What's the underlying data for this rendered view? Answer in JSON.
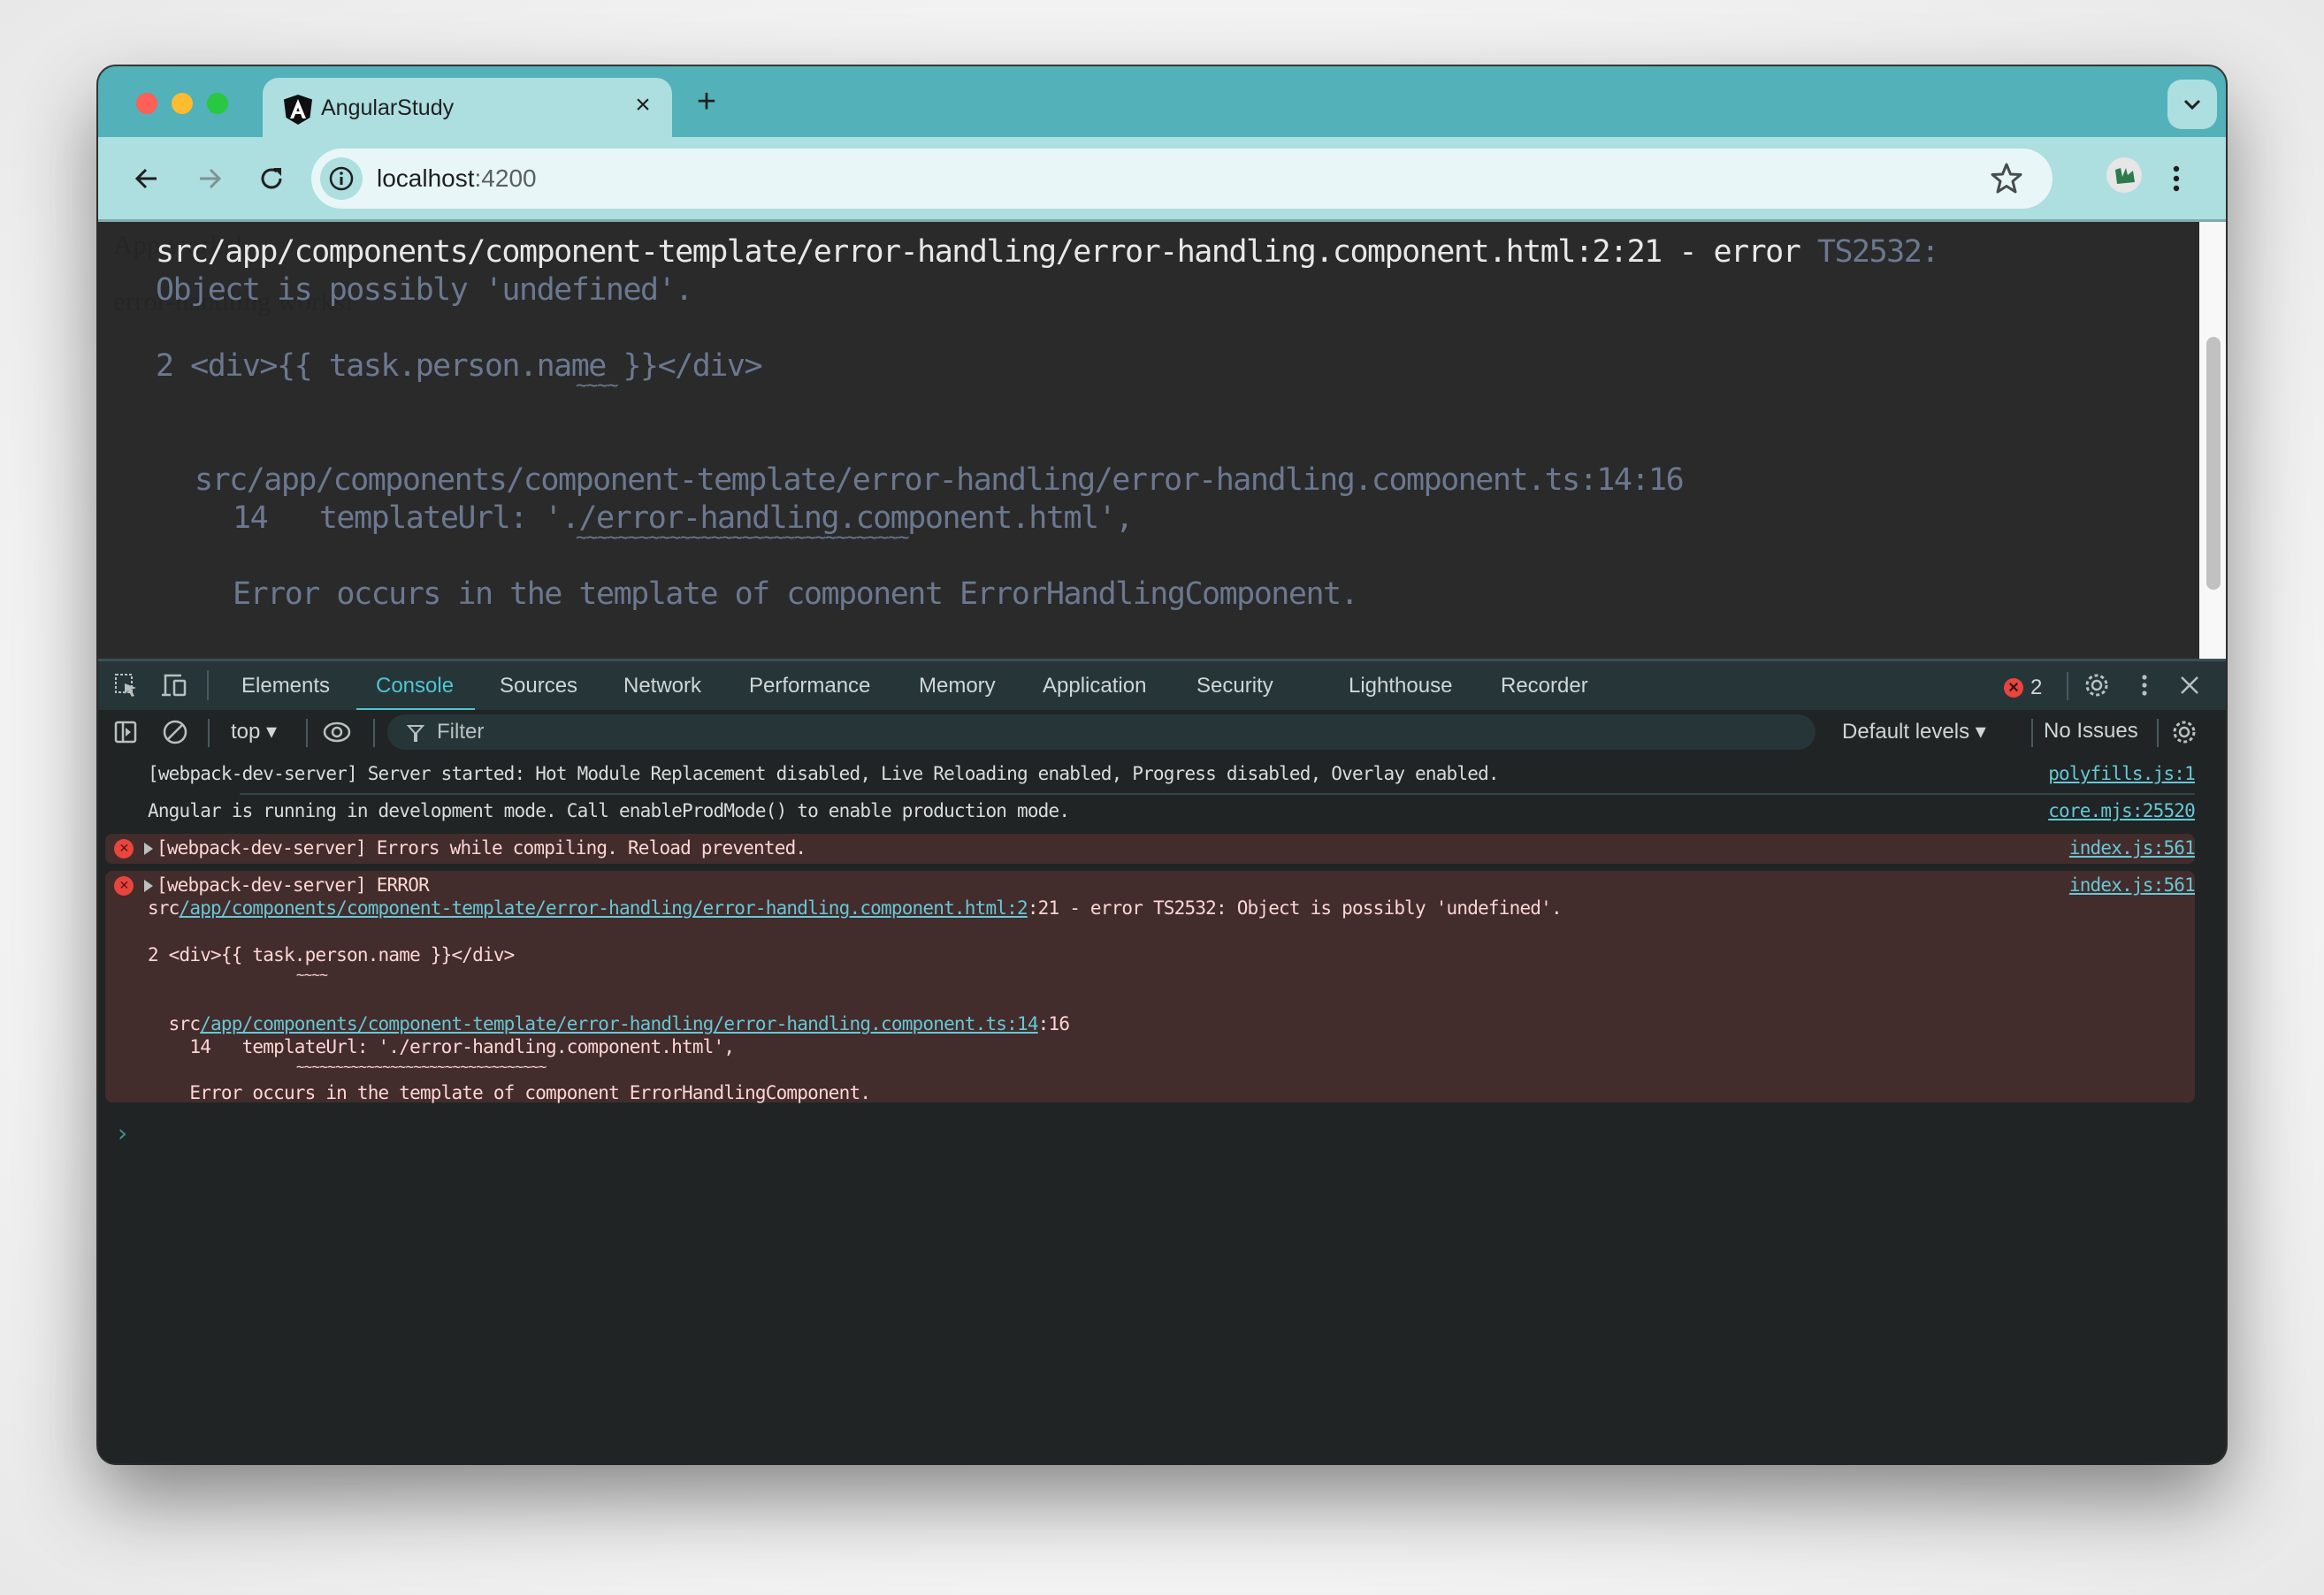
{
  "browser": {
    "tab": {
      "title": "AngularStudy",
      "favicon": "angular-icon",
      "close": "×"
    },
    "new_tab": "+",
    "address": {
      "host": "localhost",
      "port": ":4200"
    }
  },
  "page": {
    "underlying_text": [
      "App works!",
      "error-handling works!"
    ],
    "overlay": {
      "line1_white": "src/app/components/component-template/error-handling/error-handling.component.html:2:21 - error ",
      "line1_code": "TS2532:",
      "line2": "Object is possibly 'undefined'.",
      "code_line": "2 <div>{{ task.person.name }}</div>",
      "squiggle1": "~~~~",
      "ref_path": "src/app/components/component-template/error-handling/error-handling.component.ts:14:16",
      "ref_code": "14   templateUrl: './error-handling.component.html',",
      "squiggle2": "~~~~~~~~~~~~~~~~~~~~~~~~~~~~~~~~",
      "message": "Error occurs in the template of component ErrorHandlingComponent."
    }
  },
  "devtools": {
    "tabs": [
      {
        "label": "Elements"
      },
      {
        "label": "Console",
        "active": true
      },
      {
        "label": "Sources"
      },
      {
        "label": "Network"
      },
      {
        "label": "Performance"
      },
      {
        "label": "Memory"
      },
      {
        "label": "Application"
      },
      {
        "label": "Security"
      },
      {
        "label": "Lighthouse"
      },
      {
        "label": "Recorder"
      }
    ],
    "error_count": "2",
    "toolbar": {
      "context": "top ▾",
      "filter_placeholder": "Filter",
      "levels": "Default levels ▾",
      "issues": "No Issues"
    },
    "console": {
      "messages": [
        {
          "type": "info",
          "text": "[webpack-dev-server] Server started: Hot Module Replacement disabled, Live Reloading enabled, Progress disabled, Overlay enabled.",
          "source": "polyfills.js:1"
        },
        {
          "type": "info",
          "text": "Angular is running in development mode. Call enableProdMode() to enable production mode.",
          "source": "core.mjs:25520"
        },
        {
          "type": "error",
          "text": "[webpack-dev-server] Errors while compiling. Reload prevented.",
          "source": "index.js:561"
        },
        {
          "type": "error",
          "text": "[webpack-dev-server] ERROR",
          "source": "index.js:561"
        }
      ],
      "error_detail": {
        "l1_prefix": "src",
        "l1_link": "/app/components/component-template/error-handling/error-handling.component.html:2",
        "l1_suffix": ":21 - error TS2532: Object is possibly 'undefined'.",
        "l2": "2 <div>{{ task.person.name }}</div>",
        "l3": "                   ~~~~",
        "l4_prefix": "  src",
        "l4_link": "/app/components/component-template/error-handling/error-handling.component.ts:14",
        "l4_suffix": ":16",
        "l5": "    14   templateUrl: './error-handling.component.html',",
        "l6": "                   ~~~~~~~~~~~~~~~~~~~~~~~~~~~~~~~~",
        "l7": "    Error occurs in the template of component ErrorHandlingComponent."
      },
      "prompt": "›"
    }
  }
}
